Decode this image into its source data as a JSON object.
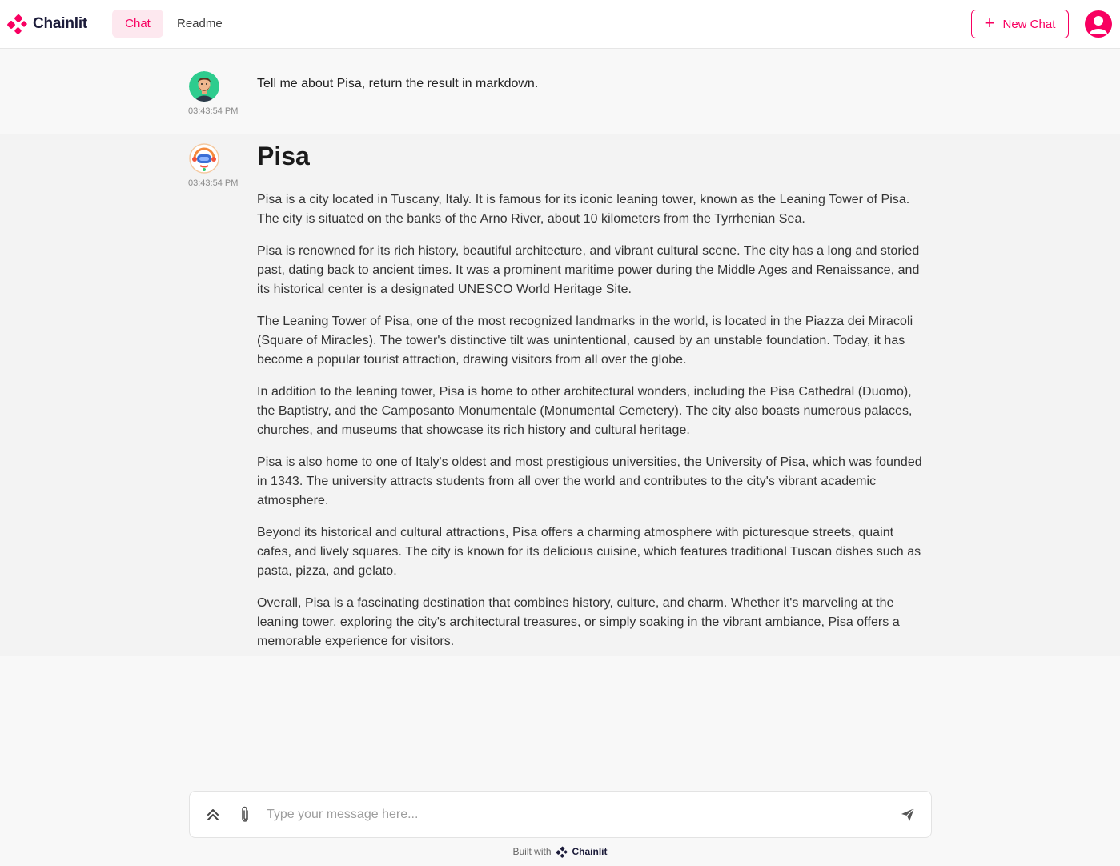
{
  "app": {
    "name": "Chainlit"
  },
  "nav": {
    "tabs": [
      {
        "label": "Chat",
        "active": true
      },
      {
        "label": "Readme",
        "active": false
      }
    ]
  },
  "header": {
    "new_chat_label": "New Chat"
  },
  "colors": {
    "accent": "#f80061",
    "tab_active_bg": "#fde8ef",
    "user_msg_bg": "#f8f8f8",
    "bot_msg_bg": "#f3f3f3"
  },
  "messages": [
    {
      "role": "user",
      "avatar": "user-avatar-icon",
      "time": "03:43:54 PM",
      "text": "Tell me about Pisa, return the result in markdown."
    },
    {
      "role": "assistant",
      "avatar": "bot-avatar-icon",
      "time": "03:43:54 PM",
      "heading": "Pisa",
      "paragraphs": [
        "Pisa is a city located in Tuscany, Italy. It is famous for its iconic leaning tower, known as the Leaning Tower of Pisa. The city is situated on the banks of the Arno River, about 10 kilometers from the Tyrrhenian Sea.",
        "Pisa is renowned for its rich history, beautiful architecture, and vibrant cultural scene. The city has a long and storied past, dating back to ancient times. It was a prominent maritime power during the Middle Ages and Renaissance, and its historical center is a designated UNESCO World Heritage Site.",
        "The Leaning Tower of Pisa, one of the most recognized landmarks in the world, is located in the Piazza dei Miracoli (Square of Miracles). The tower's distinctive tilt was unintentional, caused by an unstable foundation. Today, it has become a popular tourist attraction, drawing visitors from all over the globe.",
        "In addition to the leaning tower, Pisa is home to other architectural wonders, including the Pisa Cathedral (Duomo), the Baptistry, and the Camposanto Monumentale (Monumental Cemetery). The city also boasts numerous palaces, churches, and museums that showcase its rich history and cultural heritage.",
        "Pisa is also home to one of Italy's oldest and most prestigious universities, the University of Pisa, which was founded in 1343. The university attracts students from all over the world and contributes to the city's vibrant academic atmosphere.",
        "Beyond its historical and cultural attractions, Pisa offers a charming atmosphere with picturesque streets, quaint cafes, and lively squares. The city is known for its delicious cuisine, which features traditional Tuscan dishes such as pasta, pizza, and gelato.",
        "Overall, Pisa is a fascinating destination that combines history, culture, and charm. Whether it's marveling at the leaning tower, exploring the city's architectural treasures, or simply soaking in the vibrant ambiance, Pisa offers a memorable experience for visitors."
      ]
    }
  ],
  "composer": {
    "placeholder": "Type your message here..."
  },
  "footer": {
    "built_with": "Built with",
    "brand": "Chainlit"
  }
}
